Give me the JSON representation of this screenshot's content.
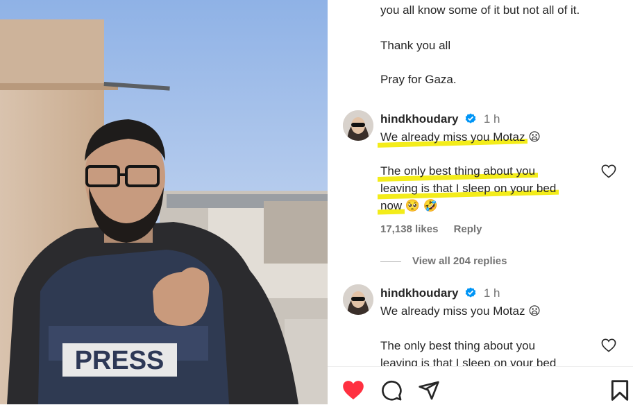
{
  "caption": {
    "cut_line": "you all know some of it but not all of it.",
    "thanks": "Thank you all",
    "pray": "Pray for Gaza."
  },
  "comments": [
    {
      "username": "hindkhoudary",
      "time": "1 h",
      "line1": "We already miss you Motaz",
      "emoji1": "😦",
      "line2": "The only best thing about you",
      "line3": "leaving is that I sleep on your bed",
      "line4": "now",
      "emoji2": "🥺 🤣",
      "likes": "17,138 likes",
      "reply": "Reply",
      "view_replies": "View all 204 replies",
      "highlighted": true
    },
    {
      "username": "hindkhoudary",
      "time": "1 h",
      "line1": "We already miss you Motaz",
      "emoji1": "😦",
      "line2": "The only best thing about you",
      "line3": "leaving is that I sleep on your bed",
      "highlighted": false
    }
  ],
  "media": {
    "vest_label": "PRESS"
  },
  "icons": {
    "like": "heart-filled-icon",
    "comment": "comment-icon",
    "share": "share-icon",
    "save": "bookmark-icon",
    "verified": "verified-badge-icon"
  },
  "colors": {
    "like_red": "#ff3040",
    "verified_blue": "#0095f6",
    "highlight": "#f3ec1a"
  }
}
